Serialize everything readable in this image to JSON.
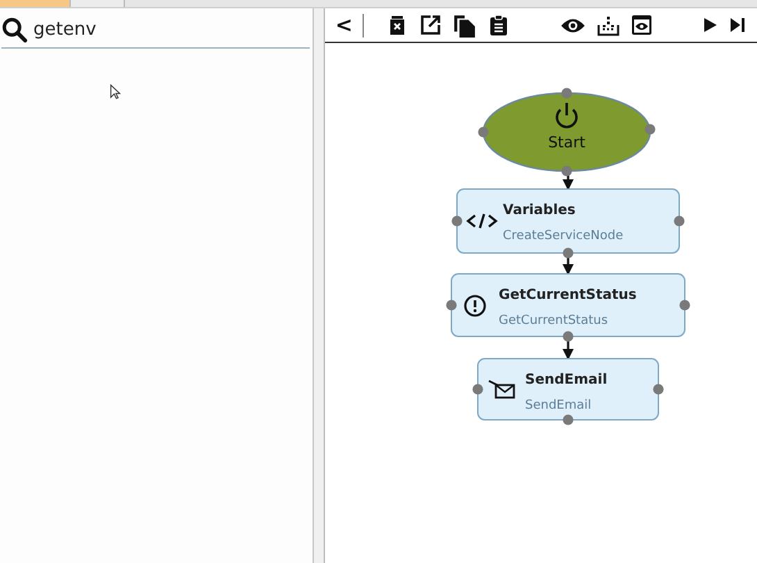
{
  "tabs": [
    {
      "selected": true
    },
    {
      "selected": false
    }
  ],
  "search": {
    "value": "getenv"
  },
  "toolbar": {
    "collapse": "<"
  },
  "flow": {
    "nodes": [
      {
        "kind": "start",
        "label": "Start"
      },
      {
        "kind": "code",
        "title": "Variables",
        "subtitle": "CreateServiceNode"
      },
      {
        "kind": "alert",
        "title": "GetCurrentStatus",
        "subtitle": "GetCurrentStatus"
      },
      {
        "kind": "email",
        "title": "SendEmail",
        "subtitle": "SendEmail"
      }
    ]
  }
}
